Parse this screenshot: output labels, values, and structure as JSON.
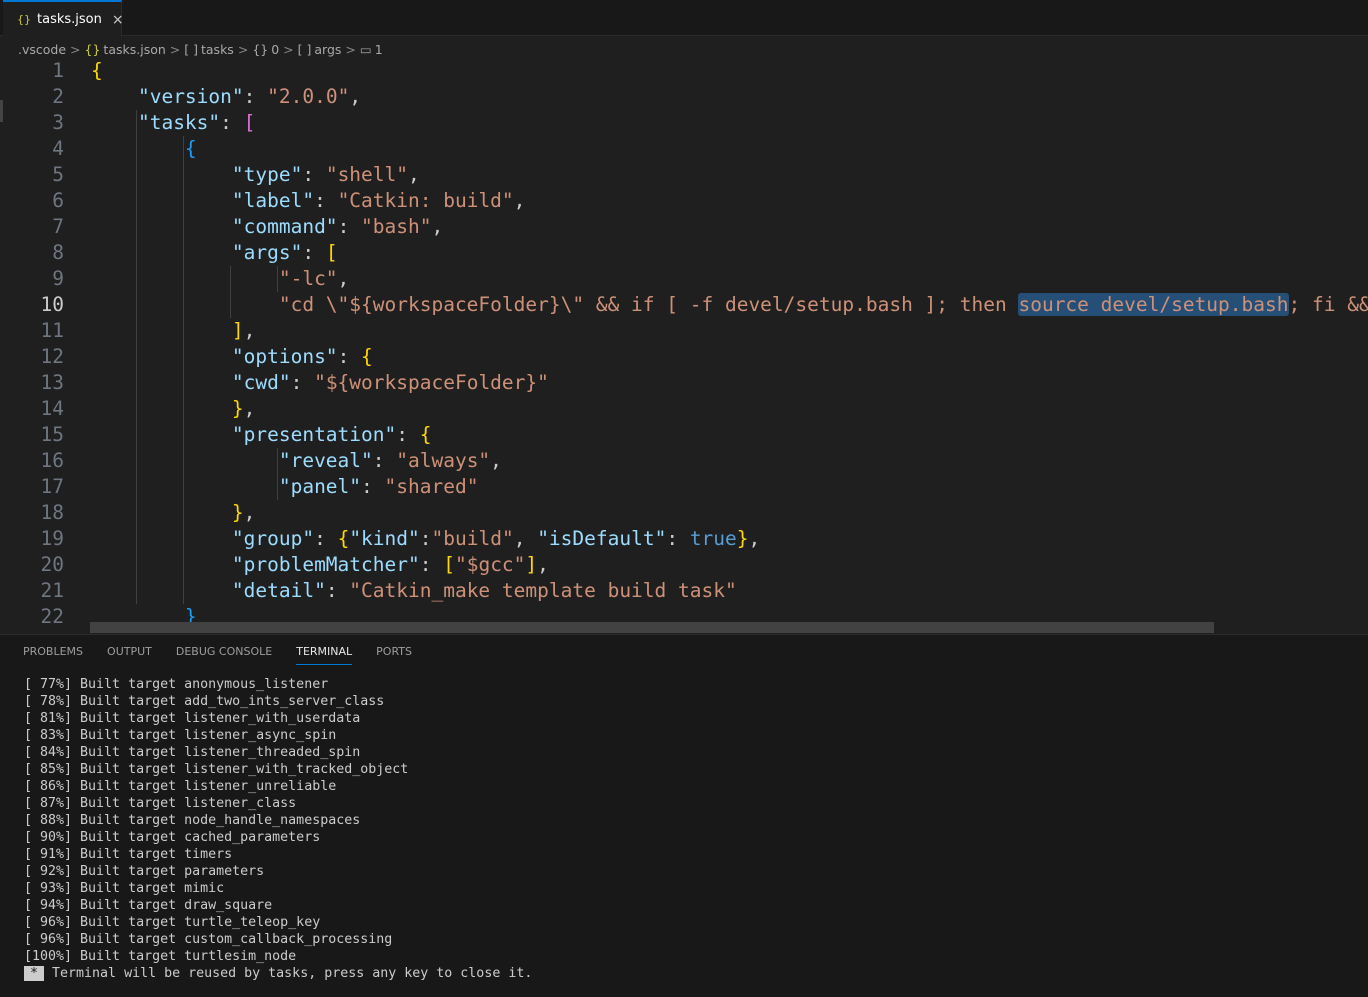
{
  "tab": {
    "icon": "{}",
    "label": "tasks.json",
    "close": "×"
  },
  "breadcrumb": [
    ".vscode",
    "{}",
    "tasks.json",
    "[ ]",
    "tasks",
    "{}",
    "0",
    "[ ]",
    "args",
    "▭",
    "1"
  ],
  "editor": {
    "current_line": 10,
    "lines": [
      [
        [
          "b1",
          "{"
        ]
      ],
      [
        [
          "p",
          "    "
        ],
        [
          "k",
          "\"version\""
        ],
        [
          "p",
          ": "
        ],
        [
          "s",
          "\"2.0.0\""
        ],
        [
          "p",
          ","
        ]
      ],
      [
        [
          "p",
          "    "
        ],
        [
          "k",
          "\"tasks\""
        ],
        [
          "p",
          ": "
        ],
        [
          "b2",
          "["
        ]
      ],
      [
        [
          "p",
          "        "
        ],
        [
          "b3",
          "{"
        ]
      ],
      [
        [
          "p",
          "            "
        ],
        [
          "k",
          "\"type\""
        ],
        [
          "p",
          ": "
        ],
        [
          "s",
          "\"shell\""
        ],
        [
          "p",
          ","
        ]
      ],
      [
        [
          "p",
          "            "
        ],
        [
          "k",
          "\"label\""
        ],
        [
          "p",
          ": "
        ],
        [
          "s",
          "\"Catkin: build\""
        ],
        [
          "p",
          ","
        ]
      ],
      [
        [
          "p",
          "            "
        ],
        [
          "k",
          "\"command\""
        ],
        [
          "p",
          ": "
        ],
        [
          "s",
          "\"bash\""
        ],
        [
          "p",
          ","
        ]
      ],
      [
        [
          "p",
          "            "
        ],
        [
          "k",
          "\"args\""
        ],
        [
          "p",
          ": "
        ],
        [
          "b1",
          "["
        ]
      ],
      [
        [
          "p",
          "                "
        ],
        [
          "s",
          "\"-lc\""
        ],
        [
          "p",
          ","
        ]
      ],
      [
        [
          "p",
          "                "
        ],
        [
          "s",
          "\"cd \\\"${workspaceFolder}\\\" && if [ -f devel/setup.bash ]; then "
        ],
        [
          "s sel",
          "source devel/setup.bash"
        ],
        [
          "s",
          "; fi && catkin_make\""
        ]
      ],
      [
        [
          "p",
          "            "
        ],
        [
          "b1",
          "]"
        ],
        [
          "p",
          ","
        ]
      ],
      [
        [
          "p",
          "            "
        ],
        [
          "k",
          "\"options\""
        ],
        [
          "p",
          ": "
        ],
        [
          "b1",
          "{"
        ]
      ],
      [
        [
          "p",
          "            "
        ],
        [
          "k",
          "\"cwd\""
        ],
        [
          "p",
          ": "
        ],
        [
          "s",
          "\"${workspaceFolder}\""
        ]
      ],
      [
        [
          "p",
          "            "
        ],
        [
          "b1",
          "}"
        ],
        [
          "p",
          ","
        ]
      ],
      [
        [
          "p",
          "            "
        ],
        [
          "k",
          "\"presentation\""
        ],
        [
          "p",
          ": "
        ],
        [
          "b1",
          "{"
        ]
      ],
      [
        [
          "p",
          "                "
        ],
        [
          "k",
          "\"reveal\""
        ],
        [
          "p",
          ": "
        ],
        [
          "s",
          "\"always\""
        ],
        [
          "p",
          ","
        ]
      ],
      [
        [
          "p",
          "                "
        ],
        [
          "k",
          "\"panel\""
        ],
        [
          "p",
          ": "
        ],
        [
          "s",
          "\"shared\""
        ]
      ],
      [
        [
          "p",
          "            "
        ],
        [
          "b1",
          "}"
        ],
        [
          "p",
          ","
        ]
      ],
      [
        [
          "p",
          "            "
        ],
        [
          "k",
          "\"group\""
        ],
        [
          "p",
          ": "
        ],
        [
          "b1",
          "{"
        ],
        [
          "k",
          "\"kind\""
        ],
        [
          "p",
          ":"
        ],
        [
          "s",
          "\"build\""
        ],
        [
          "p",
          ", "
        ],
        [
          "k",
          "\"isDefault\""
        ],
        [
          "p",
          ": "
        ],
        [
          "c",
          "true"
        ],
        [
          "b1",
          "}"
        ],
        [
          "p",
          ","
        ]
      ],
      [
        [
          "p",
          "            "
        ],
        [
          "k",
          "\"problemMatcher\""
        ],
        [
          "p",
          ": "
        ],
        [
          "b1",
          "["
        ],
        [
          "s",
          "\"$gcc\""
        ],
        [
          "b1",
          "]"
        ],
        [
          "p",
          ","
        ]
      ],
      [
        [
          "p",
          "            "
        ],
        [
          "k",
          "\"detail\""
        ],
        [
          "p",
          ": "
        ],
        [
          "s",
          "\"Catkin_make template build task\""
        ]
      ],
      [
        [
          "p",
          "        "
        ],
        [
          "b3",
          "}"
        ]
      ]
    ]
  },
  "panel": {
    "tabs": [
      "PROBLEMS",
      "OUTPUT",
      "DEBUG CONSOLE",
      "TERMINAL",
      "PORTS"
    ],
    "active": "TERMINAL"
  },
  "terminal": {
    "lines": [
      "[ 77%] Built target anonymous_listener",
      "[ 78%] Built target add_two_ints_server_class",
      "[ 81%] Built target listener_with_userdata",
      "[ 83%] Built target listener_async_spin",
      "[ 84%] Built target listener_threaded_spin",
      "[ 85%] Built target listener_with_tracked_object",
      "[ 86%] Built target listener_unreliable",
      "[ 87%] Built target listener_class",
      "[ 88%] Built target node_handle_namespaces",
      "[ 90%] Built target cached_parameters",
      "[ 91%] Built target timers",
      "[ 92%] Built target parameters",
      "[ 93%] Built target mimic",
      "[ 94%] Built target draw_square",
      "[ 96%] Built target turtle_teleop_key",
      "[ 96%] Built target custom_callback_processing",
      "[100%] Built target turtlesim_node"
    ],
    "star": "*",
    "final": " Terminal will be reused by tasks, press any key to close it."
  }
}
